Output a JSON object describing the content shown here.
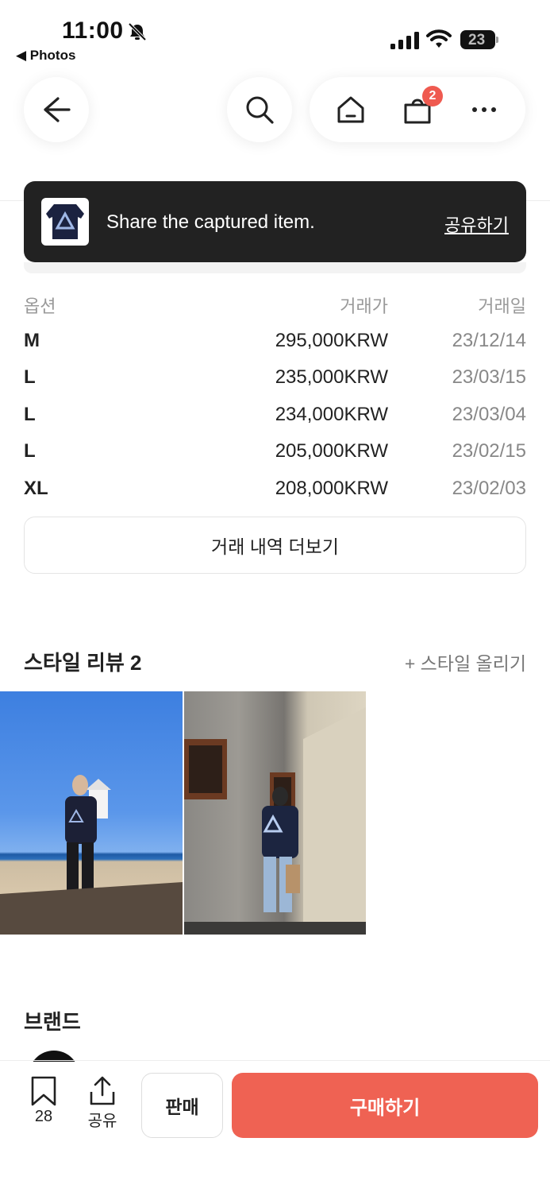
{
  "status_bar": {
    "time": "11:00",
    "back_app": "◀ Photos",
    "battery": "23"
  },
  "nav": {
    "cart_count": "2"
  },
  "toast": {
    "message": "Share the captured item.",
    "action": "공유하기"
  },
  "trades": {
    "headers": {
      "option": "옵션",
      "price": "거래가",
      "date": "거래일"
    },
    "rows": [
      {
        "option": "M",
        "price": "295,000KRW",
        "date": "23/12/14"
      },
      {
        "option": "L",
        "price": "235,000KRW",
        "date": "23/03/15"
      },
      {
        "option": "L",
        "price": "234,000KRW",
        "date": "23/03/04"
      },
      {
        "option": "L",
        "price": "205,000KRW",
        "date": "23/02/15"
      },
      {
        "option": "XL",
        "price": "208,000KRW",
        "date": "23/02/03"
      }
    ],
    "more_label": "거래 내역 더보기"
  },
  "style_review": {
    "title": "스타일 리뷰 2",
    "upload_label": "+ 스타일 올리기"
  },
  "brand": {
    "title": "브랜드"
  },
  "bottom_bar": {
    "bookmark_count": "28",
    "share_label": "공유",
    "sell_label": "판매",
    "buy_label": "구매하기"
  },
  "colors": {
    "accent": "#ef6253",
    "badge": "#ef5a50",
    "toast_bg": "#222222"
  }
}
